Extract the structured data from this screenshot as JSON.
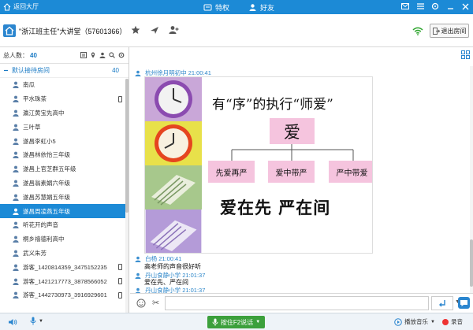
{
  "topbar": {
    "back_label": "返回大厅",
    "tabs": [
      {
        "label": "特权"
      },
      {
        "label": "好友"
      }
    ]
  },
  "room": {
    "title": "\"浙江班主任\"大讲堂（57601366）",
    "exit_label": "退出房间"
  },
  "sidebar": {
    "total_label": "总人数：",
    "total_count": "40",
    "group": {
      "label": "默认接待房间",
      "count": "40"
    },
    "users": [
      {
        "name": "南瓜",
        "device": false,
        "selected": false
      },
      {
        "name": "平水珠茶",
        "device": true,
        "selected": false
      },
      {
        "name": "瀛江黄宝先高中",
        "device": false,
        "selected": false
      },
      {
        "name": "三叶草",
        "device": false,
        "selected": false
      },
      {
        "name": "遂昌李虹小5",
        "device": false,
        "selected": false
      },
      {
        "name": "遂昌林依怡三年级",
        "device": false,
        "selected": false
      },
      {
        "name": "遂昌上官芝群五年级",
        "device": false,
        "selected": false
      },
      {
        "name": "遂昌翁素娟六年级",
        "device": false,
        "selected": false
      },
      {
        "name": "遂昌苏慧娟五年级",
        "device": false,
        "selected": false
      },
      {
        "name": "遂昌周凌燕五年级",
        "device": false,
        "selected": true
      },
      {
        "name": "听花开的声音",
        "device": false,
        "selected": false
      },
      {
        "name": "桐乡禧德利高中",
        "device": false,
        "selected": false
      },
      {
        "name": "武义朱芳",
        "device": false,
        "selected": false
      },
      {
        "name": "游客_1420814359_3475152235",
        "device": true,
        "selected": false
      },
      {
        "name": "游客_1421217773_3878566052",
        "device": true,
        "selected": false
      },
      {
        "name": "游客_1442730973_3916929601",
        "device": true,
        "selected": false
      }
    ]
  },
  "chat": {
    "messages": [
      {
        "sender": "杭州徐月明初中",
        "time": "21:00:41",
        "text": ""
      },
      {
        "sender": "白杨",
        "time": "21:00:41",
        "text": "高老师的声音很好听"
      },
      {
        "sender": "丹山食静小学",
        "time": "21:01:37",
        "text": "爱在先、严在间"
      },
      {
        "sender": "丹山食静小学",
        "time": "21:01:37",
        "text": ""
      }
    ],
    "slide": {
      "title": "有“序”的执行“师爱”",
      "center": "爱",
      "boxes": [
        "先爱再严",
        "爱中带严",
        "严中带爱"
      ],
      "big_text": "爱在先  严在间"
    }
  },
  "footer": {
    "ptt_label": "按住F2说话",
    "music_label": "播放音乐",
    "record_label": "录音"
  },
  "colors": {
    "brand_blue": "#1c8ad6",
    "ptt_green": "#3ca03c",
    "slide_pink": "#f5c4de",
    "record_red": "#e33333"
  }
}
